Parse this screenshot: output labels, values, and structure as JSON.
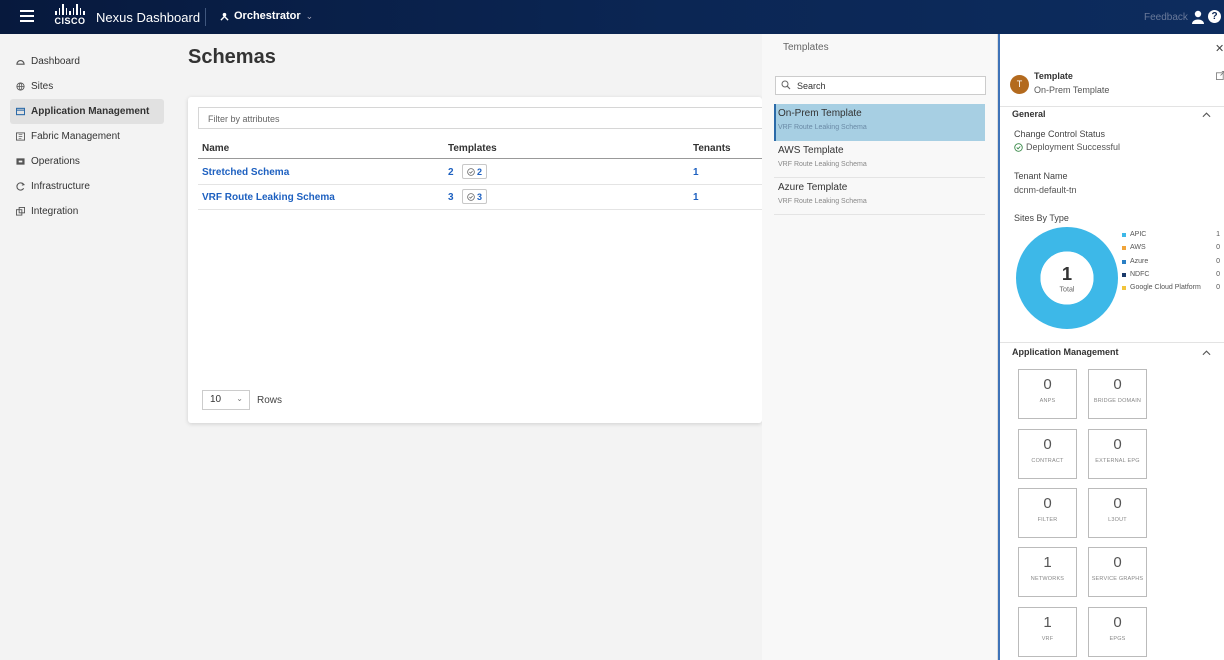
{
  "topbar": {
    "logo_text": "CISCO",
    "app_name": "Nexus Dashboard",
    "context": "Orchestrator",
    "feedback": "Feedback",
    "help": "?"
  },
  "sidebar": {
    "items": [
      {
        "label": "Dashboard",
        "icon": "dashboard-icon"
      },
      {
        "label": "Sites",
        "icon": "globe-icon"
      },
      {
        "label": "Application Management",
        "icon": "app-icon",
        "active": true
      },
      {
        "label": "Fabric Management",
        "icon": "fabric-icon"
      },
      {
        "label": "Operations",
        "icon": "operations-icon"
      },
      {
        "label": "Infrastructure",
        "icon": "infrastructure-icon"
      },
      {
        "label": "Integration",
        "icon": "integration-icon"
      }
    ]
  },
  "main": {
    "title": "Schemas",
    "filter_placeholder": "Filter by attributes",
    "columns": [
      "Name",
      "Templates",
      "Tenants"
    ],
    "rows": [
      {
        "name": "Stretched Schema",
        "templates": "2",
        "badge": "2",
        "tenants": "1"
      },
      {
        "name": "VRF Route Leaking Schema",
        "templates": "3",
        "badge": "3",
        "tenants": "1"
      }
    ],
    "rows_per_page": "10",
    "rows_label": "Rows"
  },
  "templates_panel": {
    "title": "Templates",
    "search_placeholder": "Search",
    "items": [
      {
        "name": "On-Prem Template",
        "schema": "VRF Route Leaking Schema",
        "selected": true
      },
      {
        "name": "AWS Template",
        "schema": "VRF Route Leaking Schema"
      },
      {
        "name": "Azure Template",
        "schema": "VRF Route Leaking Schema"
      }
    ]
  },
  "details": {
    "avatar": "T",
    "title": "Template",
    "subtitle": "On-Prem Template",
    "general": "General",
    "change_control_label": "Change Control Status",
    "change_control_value": "Deployment Successful",
    "tenant_label": "Tenant Name",
    "tenant_value": "dcnm-default-tn",
    "sites_label": "Sites By Type",
    "donut_total": "1",
    "donut_total_label": "Total",
    "sites_by_type": [
      {
        "name": "APIC",
        "value": "1",
        "color": "#3db8e8"
      },
      {
        "name": "AWS",
        "value": "0",
        "color": "#f0a43a"
      },
      {
        "name": "Azure",
        "value": "0",
        "color": "#2a7fc4"
      },
      {
        "name": "NDFC",
        "value": "0",
        "color": "#1b3a6b"
      },
      {
        "name": "Google Cloud Platform",
        "value": "0",
        "color": "#f2c43c"
      }
    ],
    "app_mgmt": "Application Management",
    "tiles": [
      {
        "value": "0",
        "label": "ANPS"
      },
      {
        "value": "0",
        "label": "BRIDGE DOMAIN"
      },
      {
        "value": "0",
        "label": "CONTRACT"
      },
      {
        "value": "0",
        "label": "EXTERNAL EPG"
      },
      {
        "value": "0",
        "label": "FILTER"
      },
      {
        "value": "0",
        "label": "L3OUT"
      },
      {
        "value": "1",
        "label": "NETWORKS"
      },
      {
        "value": "0",
        "label": "SERVICE GRAPHS"
      },
      {
        "value": "1",
        "label": "VRF"
      },
      {
        "value": "0",
        "label": "EPGS"
      }
    ]
  }
}
